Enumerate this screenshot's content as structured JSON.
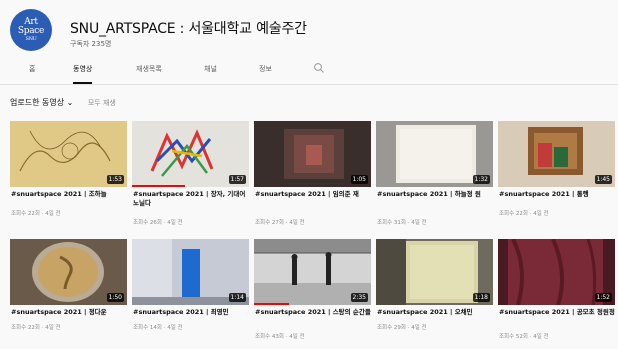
{
  "channel": {
    "logo_text": [
      "Art",
      "Space",
      "SNU"
    ],
    "title": "SNU_ARTSPACE : 서울대학교 예술주간",
    "subscribers": "구독자 235명"
  },
  "tabs": [
    {
      "label": "홈",
      "active": false
    },
    {
      "label": "동영상",
      "active": true
    },
    {
      "label": "재생목록",
      "active": false
    },
    {
      "label": "채널",
      "active": false
    },
    {
      "label": "정보",
      "active": false
    }
  ],
  "sort": {
    "primary": "업로드한 동영상",
    "chevron": "⌄",
    "secondary": "모두 재생"
  },
  "videos": [
    {
      "title": "#snuartspace 2021 | 조하늘",
      "meta": "조회수 22회 · 4일 전",
      "duration": "1:53",
      "progress": 0
    },
    {
      "title": "#snuartspace 2021 | 장자, 기대어 노닐다",
      "meta": "조회수 26회 · 4일 전",
      "duration": "1:57",
      "progress": 0.45
    },
    {
      "title": "#snuartspace 2021 | 임의준 재",
      "meta": "조회수 27회 · 4일 전",
      "duration": "1:05",
      "progress": 0
    },
    {
      "title": "#snuartspace 2021 | 하늘정 원",
      "meta": "조회수 31회 · 4일 전",
      "duration": "1:32",
      "progress": 0
    },
    {
      "title": "#snuartspace 2021 | 통행",
      "meta": "조회수 22회 · 4일 전",
      "duration": "1:45",
      "progress": 0
    },
    {
      "title": "#snuartspace 2021 | 정다운",
      "meta": "조회수 22회 · 4일 전",
      "duration": "1:50",
      "progress": 0
    },
    {
      "title": "#snuartspace 2021 | 최영민",
      "meta": "조회수 14회 · 4일 전",
      "duration": "1:14",
      "progress": 0
    },
    {
      "title": "#snuartspace 2021 | 스탕의 순간들",
      "meta": "조회수 43회 · 4일 전",
      "duration": "2:35",
      "progress": 0.3
    },
    {
      "title": "#snuartspace 2021 | 오채민",
      "meta": "조회수 29회 · 4일 전",
      "duration": "1:18",
      "progress": 0
    },
    {
      "title": "#snuartspace 2021 | 공모초 정원정",
      "meta": "조회수 52회 · 4일 전",
      "duration": "1:52",
      "progress": 0
    }
  ]
}
